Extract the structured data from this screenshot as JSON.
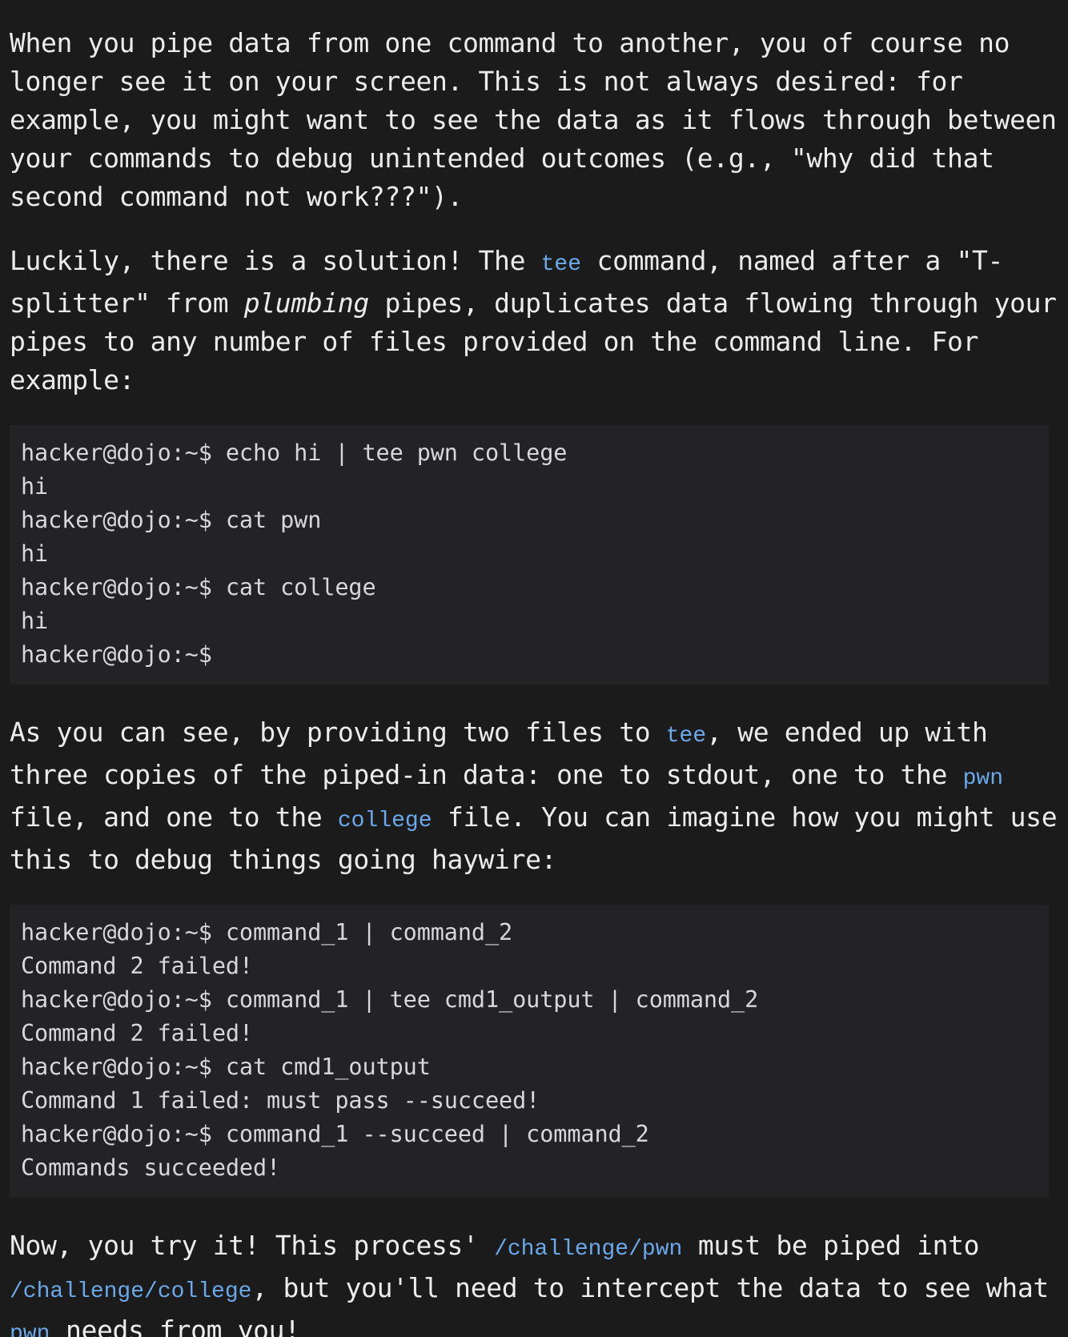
{
  "para1": {
    "text": "When you pipe data from one command to another, you of course no longer see it on your screen. This is not always desired: for example, you might want to see the data as it flows through between your commands to debug unintended outcomes (e.g., \"why did that second command not work???\")."
  },
  "para2": {
    "part1": "Luckily, there is a solution! The ",
    "code1": "tee",
    "part2": " command, named after a \"T-splitter\" from ",
    "em1": "plumbing",
    "part3": " pipes, duplicates data flowing through your pipes to any number of files provided on the command line. For example:"
  },
  "code_block_1": {
    "lines": [
      "hacker@dojo:~$ echo hi | tee pwn college",
      "hi",
      "hacker@dojo:~$ cat pwn",
      "hi",
      "hacker@dojo:~$ cat college",
      "hi",
      "hacker@dojo:~$"
    ]
  },
  "para3": {
    "part1": "As you can see, by providing two files to ",
    "code1": "tee",
    "part2": ", we ended up with three copies of the piped-in data: one to stdout, one to the ",
    "code2": "pwn",
    "part3": " file, and one to the ",
    "code3": "college",
    "part4": " file. You can imagine how you might use this to debug things going haywire:"
  },
  "code_block_2": {
    "lines": [
      "hacker@dojo:~$ command_1 | command_2",
      "Command 2 failed!",
      "hacker@dojo:~$ command_1 | tee cmd1_output | command_2",
      "Command 2 failed!",
      "hacker@dojo:~$ cat cmd1_output",
      "Command 1 failed: must pass --succeed!",
      "hacker@dojo:~$ command_1 --succeed | command_2",
      "Commands succeeded!"
    ]
  },
  "para4": {
    "part1": "Now, you try it! This process' ",
    "code1": "/challenge/pwn",
    "part2": " must be piped into ",
    "code2": "/challenge/college",
    "part3": ", but you'll need to intercept the data to see what ",
    "code3": "pwn",
    "part4": " needs from you!"
  }
}
